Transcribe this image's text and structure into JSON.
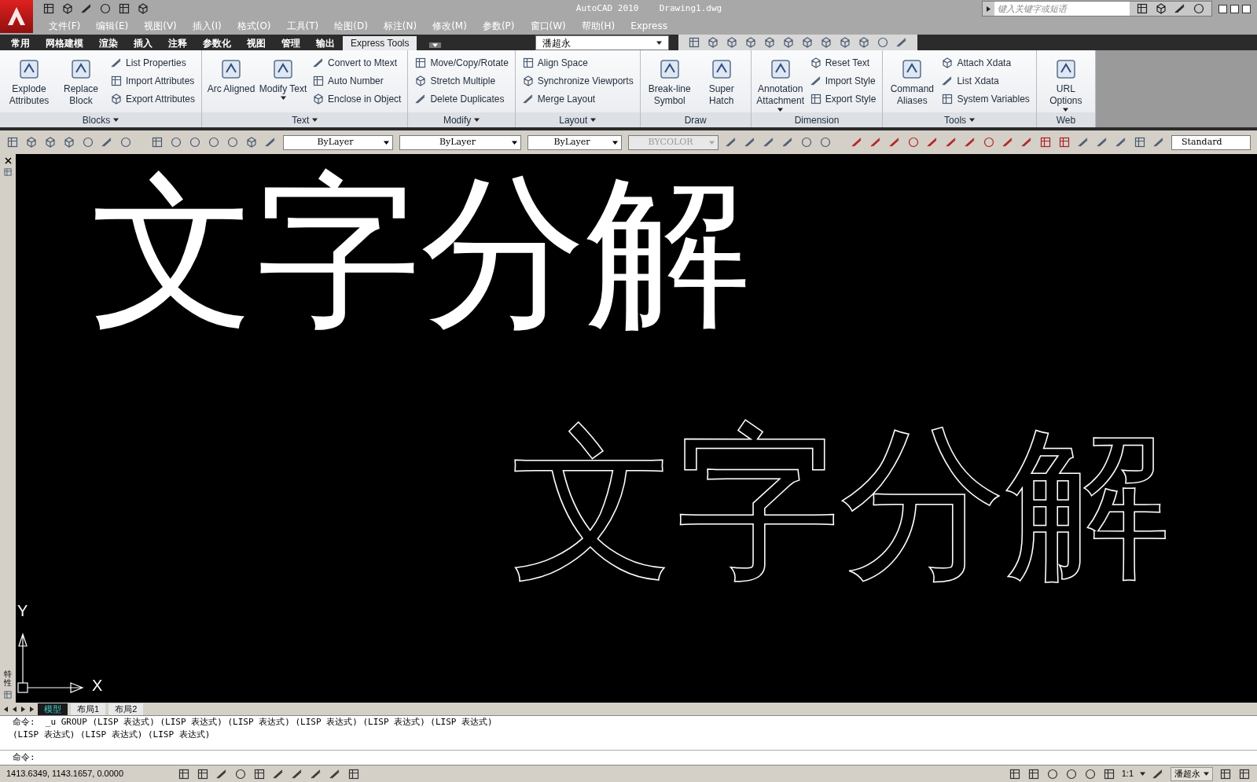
{
  "title_bar": {
    "title": "AutoCAD 2010    Drawing1.dwg",
    "search": {
      "placeholder": "键入关键字或短语"
    }
  },
  "menu": [
    "文件(F)",
    "编辑(E)",
    "视图(V)",
    "插入(I)",
    "格式(O)",
    "工具(T)",
    "绘图(D)",
    "标注(N)",
    "修改(M)",
    "参数(P)",
    "窗口(W)",
    "帮助(H)",
    "Express"
  ],
  "ribbon_tabs": [
    {
      "label": "常用",
      "selected": false
    },
    {
      "label": "网格建模",
      "selected": false
    },
    {
      "label": "渲染",
      "selected": false
    },
    {
      "label": "插入",
      "selected": false
    },
    {
      "label": "注释",
      "selected": false
    },
    {
      "label": "参数化",
      "selected": false
    },
    {
      "label": "视图",
      "selected": false
    },
    {
      "label": "管理",
      "selected": false
    },
    {
      "label": "输出",
      "selected": false
    },
    {
      "label": "Express Tools",
      "selected": true
    }
  ],
  "workspace_user": "潘超永",
  "ribbon_panels": [
    {
      "title": "Blocks",
      "dropdown": true,
      "items": [
        {
          "kind": "large",
          "label": "Explode Attributes",
          "caret": false
        },
        {
          "kind": "large",
          "label": "Replace Block",
          "caret": false
        },
        {
          "kind": "small",
          "label": "List Properties"
        },
        {
          "kind": "small",
          "label": "Import Attributes"
        },
        {
          "kind": "small",
          "label": "Export Attributes"
        }
      ]
    },
    {
      "title": "Text",
      "dropdown": true,
      "items": [
        {
          "kind": "large",
          "label": "Arc Aligned",
          "caret": false
        },
        {
          "kind": "large",
          "label": "Modify Text",
          "caret": true
        },
        {
          "kind": "small",
          "label": "Convert to Mtext"
        },
        {
          "kind": "small",
          "label": "Auto Number"
        },
        {
          "kind": "small",
          "label": "Enclose in Object"
        }
      ]
    },
    {
      "title": "Modify",
      "dropdown": true,
      "items": [
        {
          "kind": "small",
          "label": "Move/Copy/Rotate"
        },
        {
          "kind": "small",
          "label": "Stretch Multiple"
        },
        {
          "kind": "small",
          "label": "Delete Duplicates"
        }
      ]
    },
    {
      "title": "Layout",
      "dropdown": true,
      "items": [
        {
          "kind": "small",
          "label": "Align Space"
        },
        {
          "kind": "small",
          "label": "Synchronize Viewports"
        },
        {
          "kind": "small",
          "label": "Merge Layout"
        }
      ]
    },
    {
      "title": "Draw",
      "dropdown": false,
      "items": [
        {
          "kind": "large",
          "label": "Break-line Symbol",
          "caret": false
        },
        {
          "kind": "large",
          "label": "Super Hatch",
          "caret": false
        }
      ]
    },
    {
      "title": "Dimension",
      "dropdown": false,
      "items": [
        {
          "kind": "large",
          "label": "Annotation Attachment",
          "caret": true
        },
        {
          "kind": "small",
          "label": "Reset Text"
        },
        {
          "kind": "small",
          "label": "Import Style"
        },
        {
          "kind": "small",
          "label": "Export Style"
        }
      ]
    },
    {
      "title": "Tools",
      "dropdown": true,
      "items": [
        {
          "kind": "large",
          "label": "Command Aliases",
          "caret": false
        },
        {
          "kind": "small",
          "label": "Attach Xdata"
        },
        {
          "kind": "small",
          "label": "List Xdata"
        },
        {
          "kind": "small",
          "label": "System Variables"
        }
      ]
    },
    {
      "title": "Web",
      "dropdown": false,
      "items": [
        {
          "kind": "large",
          "label": "URL Options",
          "caret": true
        }
      ]
    }
  ],
  "properties_toolbar": [
    {
      "value": "ByLayer",
      "disabled": false
    },
    {
      "value": "ByLayer",
      "disabled": false
    },
    {
      "value": "ByLayer",
      "disabled": false
    },
    {
      "value": "BYCOLOR",
      "disabled": true
    }
  ],
  "text_style": "Standard",
  "palette_label": "特性",
  "canvas_texts": [
    {
      "kind": "filled",
      "text": "文字分解"
    },
    {
      "kind": "outline",
      "text": "文字分解"
    }
  ],
  "ucs": {
    "y": "Y",
    "x": "X"
  },
  "layout_tabs": [
    {
      "label": "模型",
      "selected": true
    },
    {
      "label": "布局1",
      "selected": false
    },
    {
      "label": "布局2",
      "selected": false
    }
  ],
  "command_history": [
    "命令:  _u GROUP (LISP 表达式) (LISP 表达式) (LISP 表达式) (LISP 表达式) (LISP 表达式) (LISP 表达式)",
    "(LISP 表达式) (LISP 表达式) (LISP 表达式)"
  ],
  "command_prompt": "命令:",
  "status_bar": {
    "coordinates": "1413.6349, 1143.1657, 0.0000",
    "scale": "1:1",
    "workspace": "潘超永"
  }
}
